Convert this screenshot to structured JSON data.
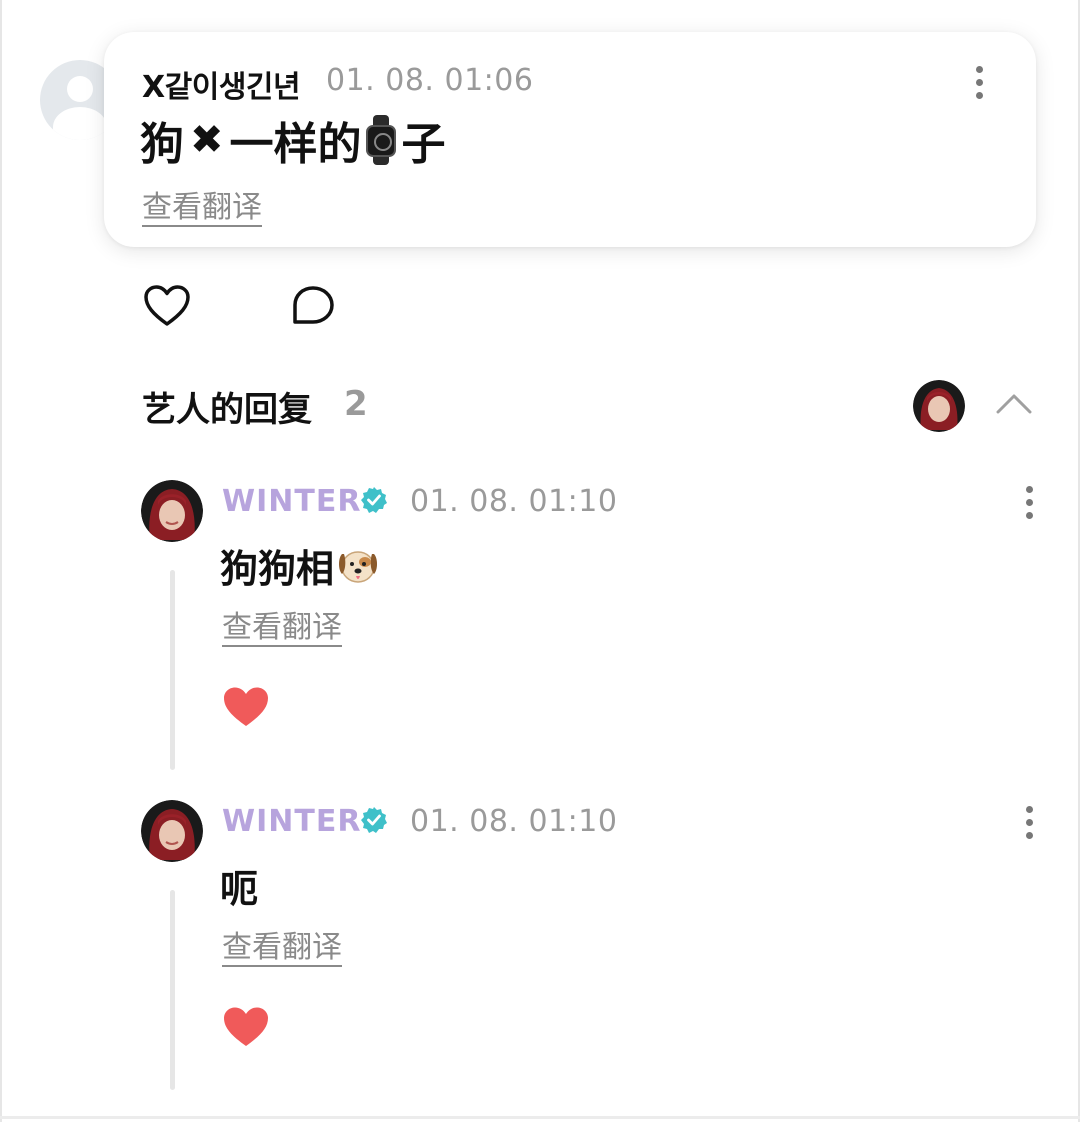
{
  "original_comment": {
    "username": "X같이생긴년",
    "timestamp": "01. 08. 01:06",
    "text_before": "狗",
    "x_mark": "✖",
    "text_middle": "一样的",
    "text_after": "子",
    "emoji_icon": "watch-icon",
    "translate_label": "查看翻译"
  },
  "actions": {
    "like_icon": "heart-outline-icon",
    "comment_icon": "comment-bubble-icon"
  },
  "replies_section": {
    "title": "艺人的回复",
    "count": "2"
  },
  "replies": [
    {
      "username": "WINTER",
      "timestamp": "01. 08. 01:10",
      "text": "狗狗相",
      "emoji_icon": "dog-face-icon",
      "translate_label": "查看翻译",
      "liked": true
    },
    {
      "username": "WINTER",
      "timestamp": "01. 08. 01:10",
      "text": "呃",
      "translate_label": "查看翻译",
      "liked": true
    }
  ],
  "colors": {
    "artist_name": "#b7a4dd",
    "verified_badge": "#3fc0c9",
    "heart_filled": "#f05a5a",
    "timestamp": "#9a9a9a"
  }
}
